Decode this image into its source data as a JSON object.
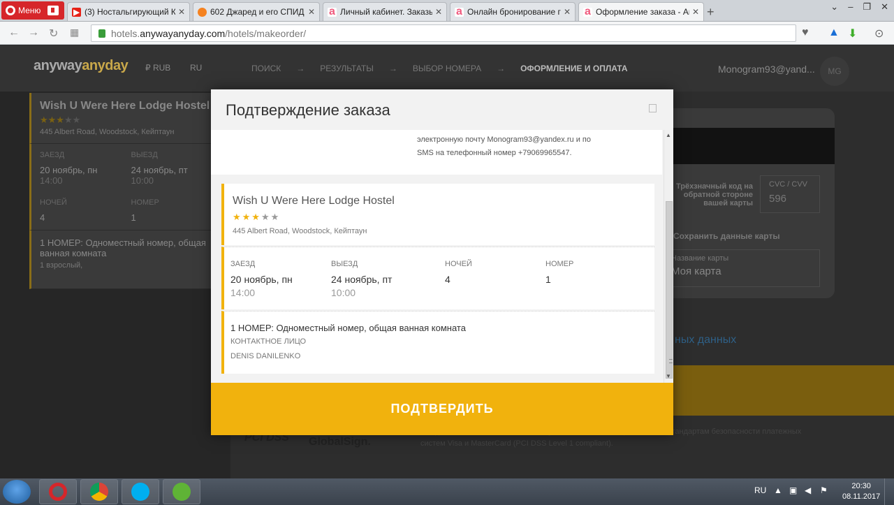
{
  "browser": {
    "menu_label": "Меню",
    "tabs": [
      {
        "label": "(3) Ностальгирующий Кр",
        "fav": "youtube-icon",
        "color": "#e62117"
      },
      {
        "label": "602 Джаред и его СПИД",
        "fav": "orange-circles-icon",
        "color": "#f58220"
      },
      {
        "label": "Личный кабинет. Заказы",
        "fav": "anywayanyday-icon",
        "color": "#f05a7e"
      },
      {
        "label": "Онлайн бронирование го",
        "fav": "anywayanyday-icon",
        "color": "#f05a7e"
      },
      {
        "label": "Оформление заказа - Any",
        "fav": "anywayanyday-icon",
        "color": "#f05a7e"
      }
    ],
    "url_host": "hotels.",
    "url_domain": "anywayanyday.com",
    "url_path": "/hotels/makeorder/"
  },
  "site": {
    "logo_a": "anyway",
    "logo_b": "anyday",
    "currency": "₽ RUB",
    "language": "RU",
    "steps": [
      "ПОИСК",
      "→",
      "РЕЗУЛЬТАТЫ",
      "→",
      "ВЫБОР НОМЕРА",
      "→",
      "ОФОРМЛЕНИЕ И ОПЛАТА"
    ],
    "user": "Monogram93@yand...",
    "avatar": "MG"
  },
  "sidebar": {
    "hotel_name": "Wish U Were Here Lodge Hostel",
    "stars_on": "★★★",
    "stars_off": "★★",
    "address": "445 Albert Road, Woodstock, Кейптаун",
    "checkin_label": "ЗАЕЗД",
    "checkin_date": "20 ноябрь, пн",
    "checkin_time": "14:00",
    "checkout_label": "ВЫЕЗД",
    "checkout_date": "24 ноябрь, пт",
    "checkout_time": "10:00",
    "nights_label": "НОЧЕЙ",
    "nights": "4",
    "room_label": "НОМЕР",
    "room": "1",
    "room_title": "1 НОМЕР: Одноместный номер, общая ванная комната",
    "guests": "1 взрослый,"
  },
  "payment": {
    "cvc_hint": "Трёхзначный код на обратной стороне вашей карты",
    "cvc_label": "CVC / CVV",
    "cvc_value": "596",
    "save_card": "Сохранить данные карты",
    "name_label": "Название карты",
    "name_value": "Моя карта",
    "more_data": "ных данных"
  },
  "footer": {
    "pci": "PCI DSS",
    "globalsign": "GlobalSign.",
    "text": "...подписанным компанией GlobalSign. Сайт в полной мере отвечает стандартам безопасности платежных систем Visa и MasterCard (PCI DSS Level 1 compliant)."
  },
  "modal": {
    "title": "Подтверждение заказа",
    "notice_line1": "электронную почту Monogram93@yandex.ru и по",
    "notice_line2": "SMS на телефонный номер +79069965547.",
    "hotel_name": "Wish U Were Here Lodge Hostel",
    "stars_on": "★★★",
    "stars_off": "★★",
    "address": "445 Albert Road, Woodstock, Кейптаун",
    "checkin_label": "ЗАЕЗД",
    "checkin_date": "20 ноябрь, пн",
    "checkin_time": "14:00",
    "checkout_label": "ВЫЕЗД",
    "checkout_date": "24 ноябрь, пт",
    "checkout_time": "10:00",
    "nights_label": "НОЧЕЙ",
    "nights": "4",
    "room_label": "НОМЕР",
    "room": "1",
    "room_title": "1 НОМЕР: Одноместный номер, общая ванная комната",
    "contact_label": "КОНТАКТНОЕ ЛИЦО",
    "contact_name": "DENIS DANILENKO",
    "confirm_label": "ПОДТВЕРДИТЬ",
    "accent_color": "#f1b20d"
  },
  "taskbar": {
    "lang": "RU",
    "time": "20:30",
    "date": "08.11.2017"
  }
}
